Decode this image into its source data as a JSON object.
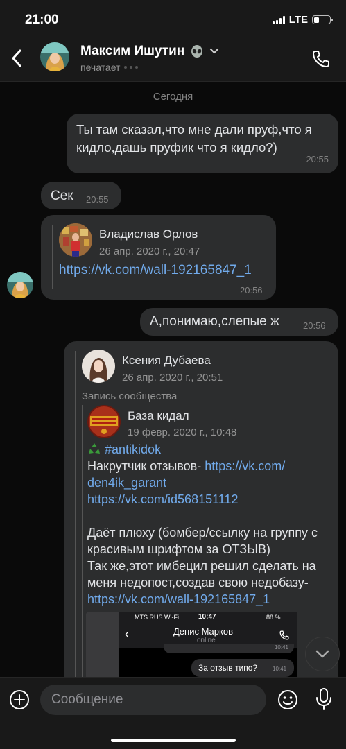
{
  "status_bar": {
    "time": "21:00",
    "network": "LTE"
  },
  "header": {
    "name": "Максим Ишутин",
    "status": "печатает"
  },
  "chat": {
    "date_separator": "Сегодня",
    "messages": {
      "m1": {
        "text": "Ты там сказал,что мне дали пруф,что я кидло,дашь пруфик что я кидло?)",
        "time": "20:55"
      },
      "m2": {
        "text": "Сек",
        "time": "20:55"
      },
      "m3": {
        "author": "Владислав Орлов",
        "date": "26 апр. 2020 г., 20:47",
        "link": "https://vk.com/wall-192165847_1",
        "time": "20:56"
      },
      "m4": {
        "text": "А,понимаю,слепые ж",
        "time": "20:56"
      },
      "m5": {
        "author": "Ксения Дубаева",
        "date": "26 апр. 2020 г., 20:51",
        "repost_label": "Запись сообщества",
        "community": "База кидал",
        "community_date": "19 февр. 2020 г., 10:48",
        "hashtag": "#antikidok",
        "line1": "Накрутчик отзывов- ",
        "link1a": "https://vk.com/",
        "link1b": "den4ik_garant",
        "link2": "https://vk.com/id568151112",
        "para2_l1": "Даёт плюху (бомбер/ссылку на группу с",
        "para2_l2": "красивым шрифтом за ОТЗЫВ)",
        "para3_l1": "Так же,этот имбецил решил сделать на",
        "para3_l2": "меня недопост,создав свою недобазу-",
        "link3": "https://vk.com/wall-192165847_1"
      }
    },
    "preview": {
      "carrier": "MTS RUS Wi-Fi",
      "time": "10:47",
      "battery": "88 %",
      "name": "Денис Марков",
      "status": "online",
      "time_cut": "10:41",
      "message": "За отзыв типо?",
      "message_time": "10:41"
    }
  },
  "composer": {
    "placeholder": "Сообщение"
  },
  "colors": {
    "background": "#0a0a0a",
    "bubble": "#2c2d2e",
    "link": "#71aaeb",
    "accent": "#5181b8"
  }
}
